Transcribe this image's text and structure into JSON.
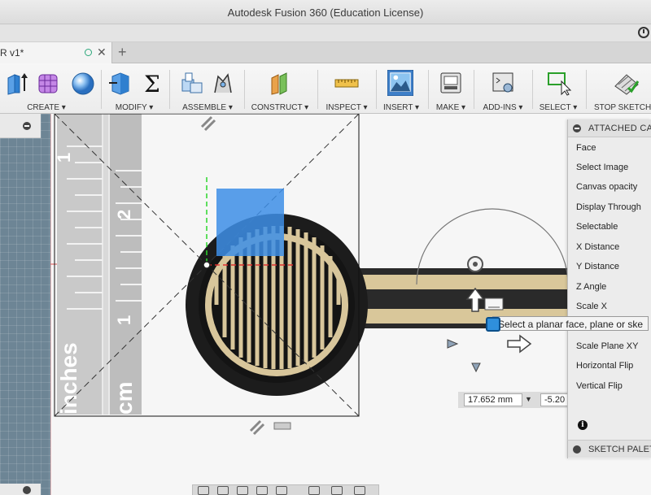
{
  "window": {
    "title": "Autodesk Fusion 360 (Education License)"
  },
  "document_tab": {
    "label": "R v1*"
  },
  "toolbar": {
    "groups": [
      {
        "label": "CREATE ▾"
      },
      {
        "label": "MODIFY ▾"
      },
      {
        "label": "ASSEMBLE ▾"
      },
      {
        "label": "CONSTRUCT ▾"
      },
      {
        "label": "INSPECT ▾"
      },
      {
        "label": "INSERT ▾"
      },
      {
        "label": "MAKE ▾"
      },
      {
        "label": "ADD-INS ▾"
      },
      {
        "label": "SELECT ▾"
      },
      {
        "label": "STOP SKETCH"
      }
    ]
  },
  "canvas": {
    "ruler_labels": [
      "1",
      "2",
      "1",
      "inches",
      "cm"
    ]
  },
  "tooltip": {
    "text": "Select a planar face, plane or ske"
  },
  "dimension_input": {
    "x_value": "17.652 mm",
    "y_value": "-5.20"
  },
  "attached_canvas_panel": {
    "title": "ATTACHED CAN",
    "items": [
      "Face",
      "Select Image",
      "Canvas opacity",
      "Display Through",
      "Selectable",
      "X Distance",
      "Y Distance",
      "Z Angle",
      "Scale X",
      "",
      "Scale Plane XY",
      "Horizontal Flip",
      "Vertical Flip"
    ],
    "info_glyph": "i"
  },
  "sketch_palette": {
    "title": "SKETCH PALETT"
  },
  "colors": {
    "accent_blue": "#2f8fdc",
    "selection_blue": "#3d8ee6",
    "axis_green": "#2bd62b",
    "axis_red": "#e03030"
  }
}
